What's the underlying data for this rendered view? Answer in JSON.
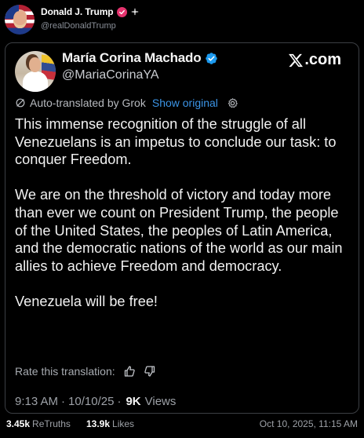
{
  "outer_post": {
    "author_name": "Donald J. Trump",
    "author_handle": "@realDonaldTrump",
    "retruths_count": "3.45k",
    "retruths_label": "ReTruths",
    "likes_count": "13.9k",
    "likes_label": "Likes",
    "timestamp": "Oct 10, 2025, 11:15 AM",
    "verified_color": "#e5336e"
  },
  "embedded_post": {
    "author_name": "María Corina Machado",
    "author_handle": "@MariaCorinaYA",
    "source": ".com",
    "translation_note": "Auto-translated by Grok",
    "show_original": "Show original",
    "paragraphs": [
      "This immense recognition of the struggle of all Venezuelans is an impetus to conclude our task: to conquer Freedom.",
      "We are on the threshold of victory and today more than ever we count on President Trump, the people of the United States, the peoples of Latin America, and the democratic nations of the world as our main allies to achieve Freedom and democracy.",
      "Venezuela will be free!"
    ],
    "rate_prompt": "Rate this translation:",
    "time": "9:13 AM",
    "date": "10/10/25",
    "separator": "·",
    "views_count": "9K",
    "views_label": "Views",
    "verified_color": "#1d9bf0",
    "link_color": "#3b94e6"
  },
  "icons": {
    "outer_verified": "verified-badge-icon",
    "pin": "pin-icon",
    "card_verified": "verified-badge-icon",
    "x_logo": "x-logo-icon",
    "grok": "grok-icon",
    "settings": "gear-icon",
    "thumbs_up": "thumbs-up-icon",
    "thumbs_down": "thumbs-down-icon"
  }
}
